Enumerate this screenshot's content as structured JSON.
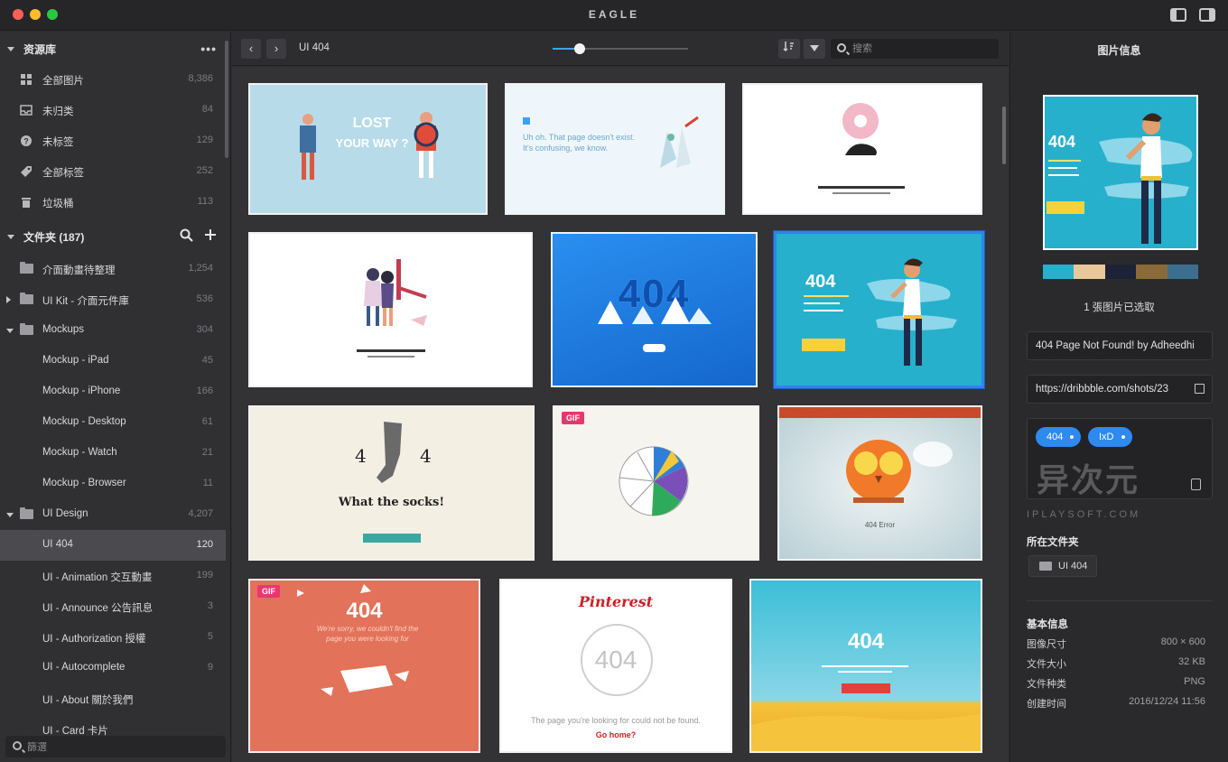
{
  "window": {
    "title": "EAGLE"
  },
  "sidebar": {
    "library_header": "资源库",
    "library_more": "•••",
    "library_items": [
      {
        "label": "全部图片",
        "count": "8,386",
        "icon": "grid-icon"
      },
      {
        "label": "未归类",
        "count": "84",
        "icon": "inbox-icon"
      },
      {
        "label": "未标签",
        "count": "129",
        "icon": "question-icon"
      },
      {
        "label": "全部标签",
        "count": "252",
        "icon": "tag-icon"
      },
      {
        "label": "垃圾桶",
        "count": "113",
        "icon": "trash-icon"
      }
    ],
    "folders_header": "文件夹 (187)",
    "folders": [
      {
        "label": "介面動畫待整理",
        "count": "1,254",
        "indent": 0,
        "toggle": "none"
      },
      {
        "label": "UI Kit - 介面元件庫",
        "count": "536",
        "indent": 0,
        "toggle": "collapsed"
      },
      {
        "label": "Mockups",
        "count": "304",
        "indent": 0,
        "toggle": "expanded"
      },
      {
        "label": "Mockup - iPad",
        "count": "45",
        "indent": 1,
        "toggle": "none"
      },
      {
        "label": "Mockup - iPhone",
        "count": "166",
        "indent": 1,
        "toggle": "none"
      },
      {
        "label": "Mockup - Desktop",
        "count": "61",
        "indent": 1,
        "toggle": "none"
      },
      {
        "label": "Mockup - Watch",
        "count": "21",
        "indent": 1,
        "toggle": "none"
      },
      {
        "label": "Mockup - Browser",
        "count": "11",
        "indent": 1,
        "toggle": "none"
      },
      {
        "label": "UI Design",
        "count": "4,207",
        "indent": 0,
        "toggle": "expanded"
      },
      {
        "label": "UI 404",
        "count": "120",
        "indent": 1,
        "toggle": "none",
        "selected": true
      },
      {
        "label": "UI - Animation 交互動畫",
        "count": "199",
        "indent": 1,
        "toggle": "none"
      },
      {
        "label": "UI - Announce 公告訊息",
        "count": "3",
        "indent": 1,
        "toggle": "none"
      },
      {
        "label": "UI - Authorization 授權",
        "count": "5",
        "indent": 1,
        "toggle": "none"
      },
      {
        "label": "UI - Autocomplete",
        "count": "9",
        "indent": 1,
        "toggle": "none"
      },
      {
        "label": "UI - About 關於我們",
        "count": "",
        "indent": 1,
        "toggle": "none"
      },
      {
        "label": "UI - Card 卡片",
        "count": "",
        "indent": 1,
        "toggle": "none"
      }
    ],
    "search_placeholder": "篩選"
  },
  "toolbar": {
    "back": "‹",
    "forward": "›",
    "breadcrumb": "UI 404",
    "zoom_level": 0.2,
    "search_placeholder": "搜索"
  },
  "grid": {
    "thumbnails": [
      {
        "title": "LOST YOUR WAY ?",
        "bg": "#b7dbe8",
        "gif": false,
        "selected": false
      },
      {
        "title": "Uh oh. That page doesn't exist. It's confusing, we know.",
        "bg": "#eef6fb",
        "gif": false,
        "selected": false
      },
      {
        "title": "",
        "bg": "#ffffff",
        "gif": false,
        "selected": false
      },
      {
        "title": "",
        "bg": "#ffffff",
        "gif": false,
        "selected": false
      },
      {
        "title": "404",
        "bg": "#1c7fdc",
        "gif": false,
        "selected": false
      },
      {
        "title": "404",
        "bg": "#27b0cc",
        "gif": false,
        "selected": true
      },
      {
        "title": "What the socks!",
        "bg": "#f4efe3",
        "gif": false,
        "selected": false
      },
      {
        "title": "",
        "bg": "#f5f4ef",
        "gif": true,
        "selected": false
      },
      {
        "title": "404 Error",
        "bg": "#cfe1e8",
        "gif": false,
        "selected": false
      },
      {
        "title": "404",
        "bg": "#e3725a",
        "gif": true,
        "selected": false
      },
      {
        "title": "404",
        "bg": "#ffffff",
        "gif": false,
        "selected": false
      },
      {
        "title": "404",
        "bg": "#3bbfd8",
        "gif": false,
        "selected": false
      }
    ],
    "thumb_texts": {
      "t1_line1": "LOST",
      "t1_line2": "YOUR WAY ?",
      "t2_text": "Uh oh. That page doesn't exist. It's confusing, we know.",
      "t5_text": "404",
      "t6_text": "404",
      "t7_left": "4",
      "t7_right": "4",
      "t7_caption": "What the socks!",
      "t9_caption": "404 Error",
      "t10_text": "404",
      "t10_sub": "We're sorry, we couldn't find the page you were looking for",
      "t11_brand": "Pinterest",
      "t11_num": "404",
      "t11_sub": "The page you're looking for could not be found.",
      "t11_link": "Go home?",
      "t12_text": "404",
      "gif_label": "GIF"
    }
  },
  "panel": {
    "title": "图片信息",
    "preview_text": "404",
    "swatches": [
      "#27b0cc",
      "#e8c89a",
      "#1e2236",
      "#8b6a3a",
      "#3a6f90"
    ],
    "selected_caption": "1 張图片已选取",
    "name": "404 Page Not Found! by Adheedhi",
    "url": "https://dribbble.com/shots/23",
    "tags": [
      "404",
      "IxD"
    ],
    "watermark": "异次元",
    "watermark_sub": "IPLAYSOFT.COM",
    "folder_label": "所在文件夹",
    "folder_value": "UI 404",
    "basic_info_label": "基本信息",
    "info": [
      {
        "k": "图像尺寸",
        "v": "800 × 600"
      },
      {
        "k": "文件大小",
        "v": "32 KB"
      },
      {
        "k": "文件种类",
        "v": "PNG"
      },
      {
        "k": "创建时间",
        "v": "2016/12/24 11:56"
      }
    ]
  }
}
